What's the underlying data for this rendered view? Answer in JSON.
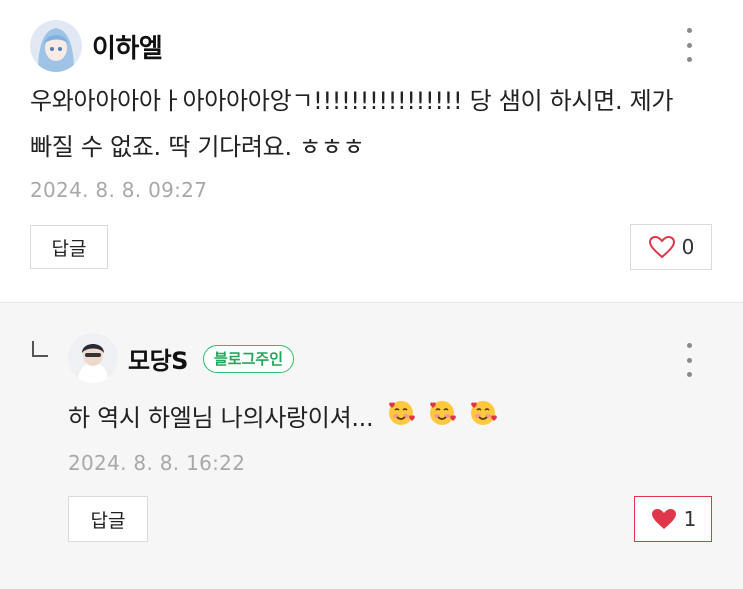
{
  "comments": [
    {
      "author": "이하엘",
      "text_lines": [
        "우와아아아아ㅏ아아아아앙ㄱ!!!!!!!!!!!!!!!! 당 샘이 하시면. 제가",
        "빠질 수 없죠. 딱 기다려요. ㅎㅎㅎ"
      ],
      "timestamp": "2024. 8. 8. 09:27",
      "reply_label": "답글",
      "like_count": "0",
      "liked": false,
      "icons": {
        "avatar": "avatar-anime-girl",
        "menu": "more-vertical-icon",
        "like": "heart-outline-icon"
      }
    },
    {
      "author": "모당S",
      "badge": "블로그주인",
      "text": "하 역시 하엘님 나의사랑이셔...",
      "emojis": [
        "smiling-face-with-hearts",
        "smiling-face-with-hearts",
        "smiling-face-with-hearts"
      ],
      "timestamp": "2024. 8. 8. 16:22",
      "reply_label": "답글",
      "like_count": "1",
      "liked": true,
      "icons": {
        "avatar": "avatar-photo",
        "menu": "more-vertical-icon",
        "like": "heart-filled-icon",
        "reply": "reply-arrow-icon"
      }
    }
  ],
  "colors": {
    "badge": "#2ec06a",
    "liked_heart": "#e0364b",
    "outline_heart": "#e0364b",
    "reply_bg": "#f6f6f6"
  }
}
